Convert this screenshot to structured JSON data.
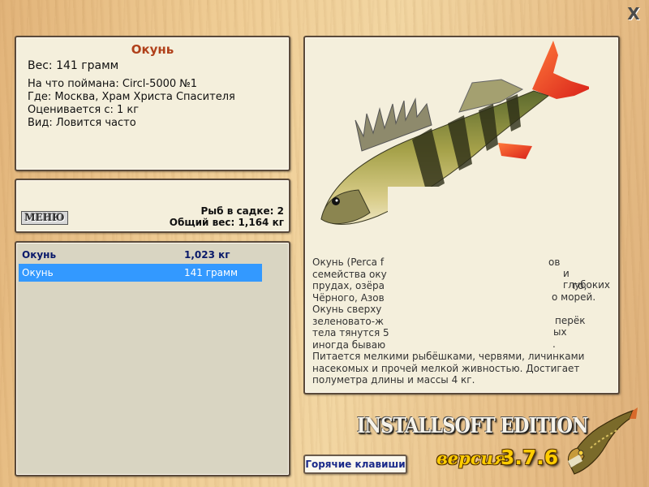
{
  "window": {
    "close_label": "X"
  },
  "info": {
    "title": "Окунь",
    "weight": "Вес: 141 грамм",
    "lines": [
      "На что поймана: Circl-5000 №1",
      "Где: Москва, Храм Христа Спасителя",
      "Оценивается с: 1 кг",
      "Вид: Ловится часто"
    ]
  },
  "keepnet": {
    "menu_label": "МЕНЮ",
    "fish_count": "Рыб в садке: 2",
    "total_weight": "Общий вес: 1,164 кг"
  },
  "catch_list": {
    "rows": [
      {
        "name": "Окунь",
        "weight": "1,023 кг",
        "style": "header"
      },
      {
        "name": "Окунь",
        "weight": "141 грамм",
        "style": "selected"
      }
    ]
  },
  "description": {
    "image_icon": "perch-fish-image",
    "lines": [
      "Окунь (Perca f",
      "семейства оку",
      "прудах, озёра",
      "Чёрного, Азов",
      "Окунь сверху",
      "зеленовато-ж",
      "тела тянутся 5",
      "иногда бываю",
      "Питается мелкими рыбёшками, червями, личинками",
      "насекомых и прочей мелкой живностью. Достигает",
      "полуметра длины и массы 4 кг."
    ],
    "fragments": [
      "ов",
      "и глубоких",
      "го,",
      "о морей.",
      "перёк",
      "ых",
      "."
    ]
  },
  "footer": {
    "hotkeys_label": "Горячие клавиши",
    "edition": "INSTALLSOFT EDITION",
    "version_label": "версия",
    "version_number": "3.7.6",
    "logo_icon": "pike-fish-logo"
  },
  "colors": {
    "title": "#b0401a",
    "list_header": "#0a1a6a",
    "selection": "#3399ff",
    "version": "#ffcc00"
  }
}
